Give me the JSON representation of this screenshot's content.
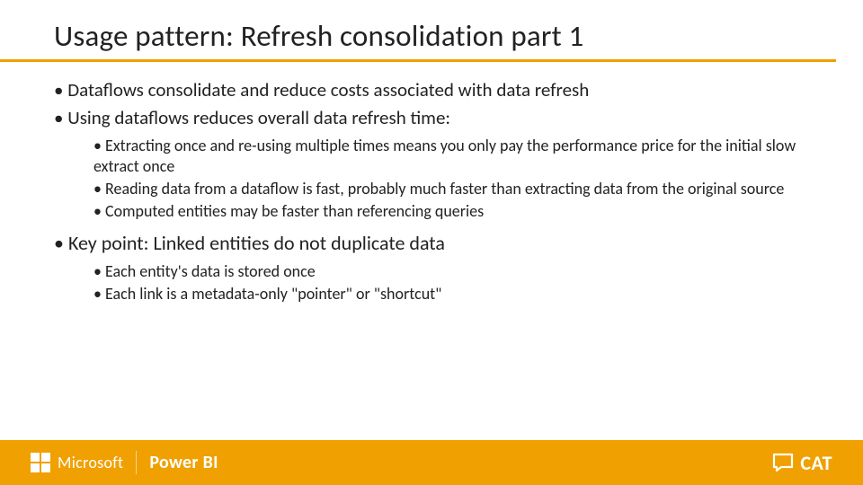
{
  "title": "Usage pattern: Refresh consolidation part 1",
  "bullets": {
    "b1": "Dataflows consolidate and reduce costs associated with data refresh",
    "b2": "Using dataflows reduces overall data refresh time:",
    "b2sub": {
      "s1": "Extracting once and re-using multiple times means you only pay the performance price for the initial slow extract once",
      "s2": "Reading data from a dataflow is fast, probably much faster than extracting data from the original source",
      "s3": "Computed entities may be faster than referencing queries"
    },
    "b3": "Key point: Linked entities do not duplicate data",
    "b3sub": {
      "s1": "Each entity's data is stored once",
      "s2": "Each link is a metadata-only \"pointer\" or \"shortcut\""
    }
  },
  "footer": {
    "microsoft": "Microsoft",
    "powerbi": "Power BI",
    "cat": "CAT"
  }
}
